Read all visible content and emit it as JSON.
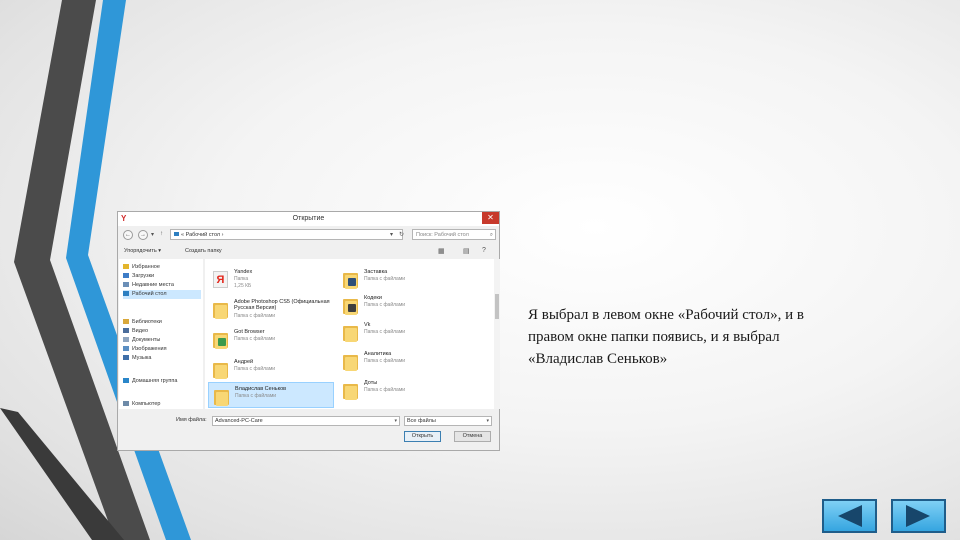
{
  "colors": {
    "stripe_dark": "#4a4a4a",
    "stripe_blue": "#2f97d8",
    "nav_button_fill": "#49aee6",
    "selection": "#cce8ff",
    "close_button": "#c7392b"
  },
  "dialog": {
    "title": "Открытие",
    "close_glyph": "✕",
    "address_path": "« Рабочий стол ›",
    "search_placeholder": "Поиск: Рабочий стол",
    "toolbar": {
      "organize_label": "Упорядочить ▾",
      "new_folder_label": "Создать папку"
    },
    "nav_pane": {
      "items": [
        {
          "label": "Избранное",
          "icon": "star-icon"
        },
        {
          "label": "Загрузки",
          "icon": "downloads-icon"
        },
        {
          "label": "Недавние места",
          "icon": "recent-places-icon"
        },
        {
          "label": "Рабочий стол",
          "icon": "desktop-icon",
          "selected": true
        },
        {
          "label": "Библиотеки",
          "icon": "libraries-icon"
        },
        {
          "label": "Видео",
          "icon": "video-icon"
        },
        {
          "label": "Документы",
          "icon": "documents-icon"
        },
        {
          "label": "Изображения",
          "icon": "pictures-icon"
        },
        {
          "label": "Музыка",
          "icon": "music-icon"
        },
        {
          "label": "Домашняя группа",
          "icon": "homegroup-icon"
        },
        {
          "label": "Компьютер",
          "icon": "computer-icon"
        }
      ]
    },
    "files": [
      {
        "name": "Yandex",
        "line2": "Папка",
        "line3": "1,25 КБ",
        "icon": "yandex-icon"
      },
      {
        "name": "Adobe Photoshop CS5 (Официальная Русская Версия)",
        "line2": "Папка с файлами",
        "icon": "photoshop-folder-icon"
      },
      {
        "name": "Got Browser",
        "line2": "Папка с файлами",
        "icon": "folder-icon"
      },
      {
        "name": "Андрей",
        "line2": "Папка с файлами",
        "icon": "folder-icon"
      },
      {
        "name": "Владислав Сеньков",
        "line2": "Папка с файлами",
        "icon": "folder-icon",
        "selected": true
      },
      {
        "name": "Заставка",
        "line2": "Папка с файлами",
        "icon": "folder-icon"
      },
      {
        "name": "Кодеки",
        "line2": "Папка с файлами",
        "icon": "folder-icon"
      },
      {
        "name": "Vk",
        "line2": "Папка с файлами",
        "icon": "folder-icon"
      },
      {
        "name": "Аналитика",
        "line2": "Папка с файлами",
        "icon": "folder-icon"
      },
      {
        "name": "Доты",
        "line2": "Папка с файлами",
        "icon": "folder-icon"
      }
    ],
    "filename_label": "Имя файла:",
    "filename_value": "Advanced-PC-Care",
    "filetype_value": "Все файлы",
    "dropdown_glyph": "▾",
    "open_button": "Открыть",
    "cancel_button": "Отмена"
  },
  "caption": {
    "line1": "Я выбрал в левом окне «Рабочий стол», и в",
    "line2": "правом окне папки появись, и я выбрал",
    "line3": "«Владислав Сеньков»"
  },
  "navigation": {
    "prev_icon": "triangle-left-icon",
    "next_icon": "triangle-right-icon"
  }
}
